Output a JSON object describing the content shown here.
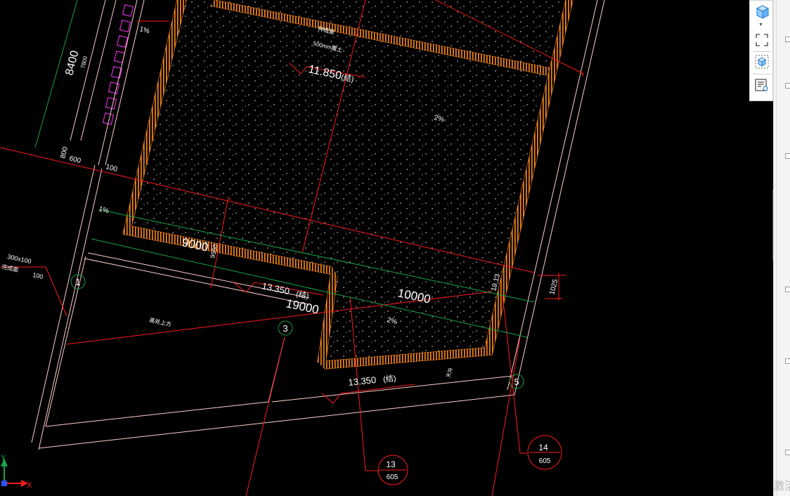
{
  "drawing": {
    "dims": {
      "d8400": "8400",
      "d7800": "7800",
      "d800": "800",
      "d600": "600",
      "d100": "100",
      "d9000": "9000",
      "d19000": "19000",
      "d10000": "10000",
      "d1025": "1025",
      "d19_13": "19.13",
      "d9550": "9550"
    },
    "elevations": {
      "top": "11.850",
      "top_suffix": "(结)",
      "mid": "13.350",
      "mid_suffix": "(结)",
      "low": "13.350",
      "low_suffix": "(结)"
    },
    "slopes": {
      "s1": "1%",
      "s2": "1%",
      "s3": "2%",
      "s4": "2%"
    },
    "notes": {
      "roof_note": "种植屋",
      "roof_note2": "500mm覆土",
      "beam_label": "300x100",
      "beam_sub": "完成面",
      "beam_val": "100",
      "room_label": "高处上方",
      "small_label": "天沟"
    },
    "axes": {
      "a1": "1",
      "a3": "3",
      "a5": "5"
    },
    "details": {
      "d13_top": "13",
      "d13_bottom": "605",
      "d14_top": "14",
      "d14_bottom": "605"
    },
    "ucs": {
      "x": "X",
      "y": "Y"
    }
  },
  "toolbar": {
    "buttons": [
      "view-cube-icon",
      "fullscreen-icon",
      "model-view-icon",
      "properties-icon"
    ]
  },
  "watermark": "激活",
  "colors": {
    "orange": "#ff8a1e",
    "red": "#ff1a1a",
    "green": "#16a34a",
    "magenta": "#ff33ff",
    "pink": "#ffb3b3"
  }
}
